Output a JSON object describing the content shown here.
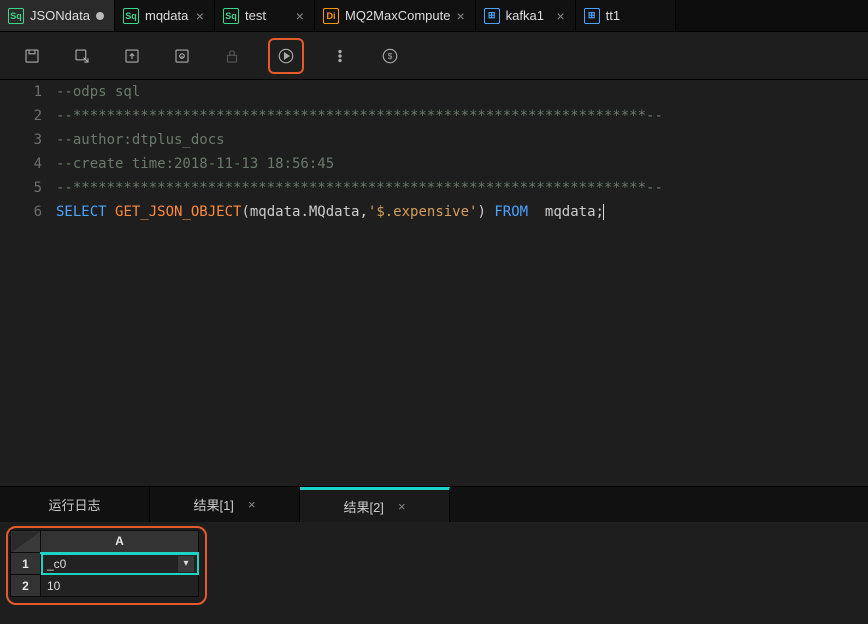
{
  "tabs": [
    {
      "icon": "Sq",
      "iconKind": "sq",
      "label": "JSONdata",
      "dirty": true,
      "active": true
    },
    {
      "icon": "Sq",
      "iconKind": "sq",
      "label": "mqdata",
      "closable": true
    },
    {
      "icon": "Sq",
      "iconKind": "sq",
      "label": "test",
      "closable": true
    },
    {
      "icon": "Di",
      "iconKind": "di",
      "label": "MQ2MaxCompute",
      "closable": true
    },
    {
      "icon": "⊞",
      "iconKind": "tbl",
      "label": "kafka1",
      "closable": true
    },
    {
      "icon": "⊞",
      "iconKind": "tbl",
      "label": "tt1",
      "closable": true
    }
  ],
  "code": {
    "lines": [
      "1",
      "2",
      "3",
      "4",
      "5",
      "6"
    ],
    "l1": "--odps sql",
    "l2": "--********************************************************************--",
    "l3": "--author:dtplus_docs",
    "l4": "--create time:2018-11-13 18:56:45",
    "l5": "--********************************************************************--",
    "l6_select": "SELECT",
    "l6_fn": "GET_JSON_OBJECT",
    "l6_open": "(mqdata.MQdata,",
    "l6_str": "'$.expensive'",
    "l6_close": ")",
    "l6_from": "FROM",
    "l6_tail": "  mqdata;"
  },
  "resultTabs": {
    "log": "运行日志",
    "r1": "结果[1]",
    "r2": "结果[2]"
  },
  "grid": {
    "col": "A",
    "rows": [
      "1",
      "2"
    ],
    "cells": {
      "A1": "_c0",
      "A2": "10"
    }
  }
}
